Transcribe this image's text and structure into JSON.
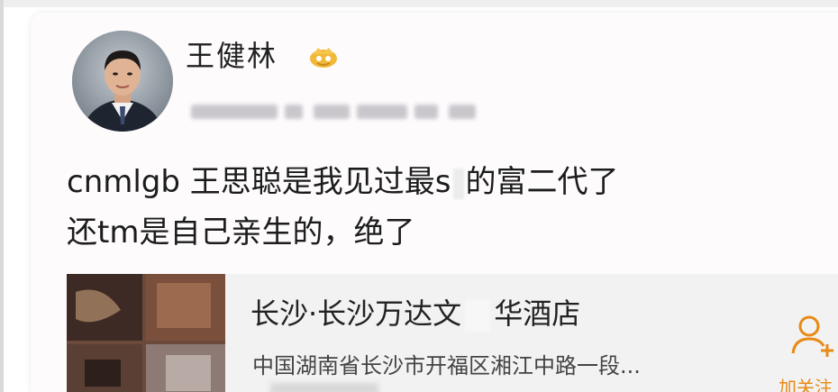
{
  "post": {
    "author": {
      "name": "王健林",
      "avatar_icon": "person-in-suit-avatar",
      "badge_icon": "gold-verified-crown-icon"
    },
    "text": {
      "line1_before": "cnmlgb 王思聪是我见过最s",
      "line1_after": "的富二代了",
      "line2": "还tm是自己亲生的，绝了"
    }
  },
  "location": {
    "name_before": "长沙·长沙万达文",
    "name_after": "华酒店",
    "address": "中国湖南省长沙市开福区湘江中路一段...",
    "follow_label": "加关注",
    "follow_icon": "add-person-icon"
  },
  "colors": {
    "accent": "#e88a15",
    "text": "#1c1c1c",
    "card_background": "#fdfbfc",
    "location_background": "#f2f2f2"
  }
}
